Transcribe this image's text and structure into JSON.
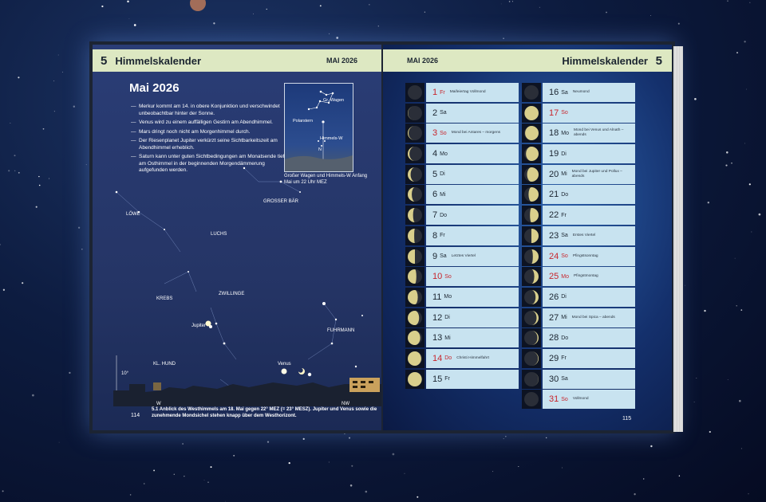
{
  "left_page": {
    "chapter_number": "5",
    "header_title": "Himmelskalender",
    "header_month": "MAI 2026",
    "title": "Mai 2026",
    "bullets": [
      "Merkur kommt am 14. in obere Konjunktion und verschwindet unbeobachtbar hinter der Sonne.",
      "Venus wird zu einem auffälligen Gestirn am Abendhimmel.",
      "Mars dringt noch nicht am Morgenhimmel durch.",
      "Der Riesenplanet Jupiter verkürzt seine Sichtbarkeitszeit am Abendhimmel erheblich.",
      "Saturn kann unter guten Sichtbedingungen am Monatsende tief am Osthimmel in der beginnenden Morgendämmerung aufgefunden werden."
    ],
    "inset": {
      "labels": [
        "Gr. Wagen",
        "Polarstern",
        "Himmels-W",
        "N"
      ],
      "caption": "Großer Wagen und Himmels-W Anfang Mai um 22 Uhr MEZ"
    },
    "sky_labels": {
      "loewe": "LÖWE",
      "grosser_baer": "GROSSER BÄR",
      "luchs": "LUCHS",
      "krebs": "KREBS",
      "zwillinge": "ZWILLINGE",
      "jupiter": "Jupiter",
      "fuhrmann": "FUHRMANN",
      "kl_hund": "KL. HUND",
      "venus": "Venus",
      "altitude": "10°",
      "dir_w": "W",
      "dir_nw": "NW"
    },
    "caption": "5.1 Anblick des Westhimmels am 18. Mai gegen 22° MEZ (= 23° MESZ). Jupiter und Venus sowie die zunehmende Mondsichel stehen knapp über dem Westhorizont.",
    "page_number": "114"
  },
  "right_page": {
    "chapter_number": "5",
    "header_title": "Himmelskalender",
    "header_month": "MAI 2026",
    "page_number": "115",
    "days": [
      {
        "day": "1",
        "wd": "Fr",
        "red": true,
        "note": "Maifeiertag Vollmond",
        "phase": 1.0
      },
      {
        "day": "2",
        "wd": "Sa",
        "red": false,
        "note": "",
        "phase": 0.98
      },
      {
        "day": "3",
        "wd": "So",
        "red": true,
        "note": "Mond bei Antares – morgens",
        "phase": 0.94
      },
      {
        "day": "4",
        "wd": "Mo",
        "red": false,
        "note": "",
        "phase": 0.88
      },
      {
        "day": "5",
        "wd": "Di",
        "red": false,
        "note": "",
        "phase": 0.8
      },
      {
        "day": "6",
        "wd": "Mi",
        "red": false,
        "note": "",
        "phase": 0.72
      },
      {
        "day": "7",
        "wd": "Do",
        "red": false,
        "note": "",
        "phase": 0.63
      },
      {
        "day": "8",
        "wd": "Fr",
        "red": false,
        "note": "",
        "phase": 0.55
      },
      {
        "day": "9",
        "wd": "Sa",
        "red": false,
        "note": "Letztes Viertel",
        "phase": 0.5
      },
      {
        "day": "10",
        "wd": "So",
        "red": true,
        "note": "",
        "phase": 0.4
      },
      {
        "day": "11",
        "wd": "Mo",
        "red": false,
        "note": "",
        "phase": 0.3
      },
      {
        "day": "12",
        "wd": "Di",
        "red": false,
        "note": "",
        "phase": 0.21
      },
      {
        "day": "13",
        "wd": "Mi",
        "red": false,
        "note": "",
        "phase": 0.13
      },
      {
        "day": "14",
        "wd": "Do",
        "red": true,
        "note": "Christi Himmelfahrt",
        "phase": 0.06
      },
      {
        "day": "15",
        "wd": "Fr",
        "red": false,
        "note": "",
        "phase": 0.02
      },
      {
        "day": "16",
        "wd": "Sa",
        "red": false,
        "note": "Neumond",
        "phase": 0.0
      },
      {
        "day": "17",
        "wd": "So",
        "red": true,
        "note": "",
        "phase": 0.02
      },
      {
        "day": "18",
        "wd": "Mo",
        "red": false,
        "note": "Mond bei Venus und Alnath – abends",
        "phase": 0.06
      },
      {
        "day": "19",
        "wd": "Di",
        "red": false,
        "note": "",
        "phase": 0.12
      },
      {
        "day": "20",
        "wd": "Mi",
        "red": false,
        "note": "Mond bei Jupiter und Pollux – abends",
        "phase": 0.2
      },
      {
        "day": "21",
        "wd": "Do",
        "red": false,
        "note": "",
        "phase": 0.3
      },
      {
        "day": "22",
        "wd": "Fr",
        "red": false,
        "note": "",
        "phase": 0.4
      },
      {
        "day": "23",
        "wd": "Sa",
        "red": false,
        "note": "Erstes Viertel",
        "phase": 0.5
      },
      {
        "day": "24",
        "wd": "So",
        "red": true,
        "note": "Pfingstsonntag",
        "phase": 0.6
      },
      {
        "day": "25",
        "wd": "Mo",
        "red": true,
        "note": "Pfingstmontag",
        "phase": 0.7
      },
      {
        "day": "26",
        "wd": "Di",
        "red": false,
        "note": "",
        "phase": 0.79
      },
      {
        "day": "27",
        "wd": "Mi",
        "red": false,
        "note": "Mond bei Spica – abends",
        "phase": 0.86
      },
      {
        "day": "28",
        "wd": "Do",
        "red": false,
        "note": "",
        "phase": 0.92
      },
      {
        "day": "29",
        "wd": "Fr",
        "red": false,
        "note": "",
        "phase": 0.96
      },
      {
        "day": "30",
        "wd": "Sa",
        "red": false,
        "note": "",
        "phase": 0.99
      },
      {
        "day": "31",
        "wd": "So",
        "red": true,
        "note": "Vollmond",
        "phase": 1.0
      }
    ]
  },
  "colors": {
    "header_bg": "#dde8c2",
    "cell_bg": "#c8e3f0",
    "holiday_red": "#c8252c",
    "moon_lit": "#d9cf8c"
  }
}
